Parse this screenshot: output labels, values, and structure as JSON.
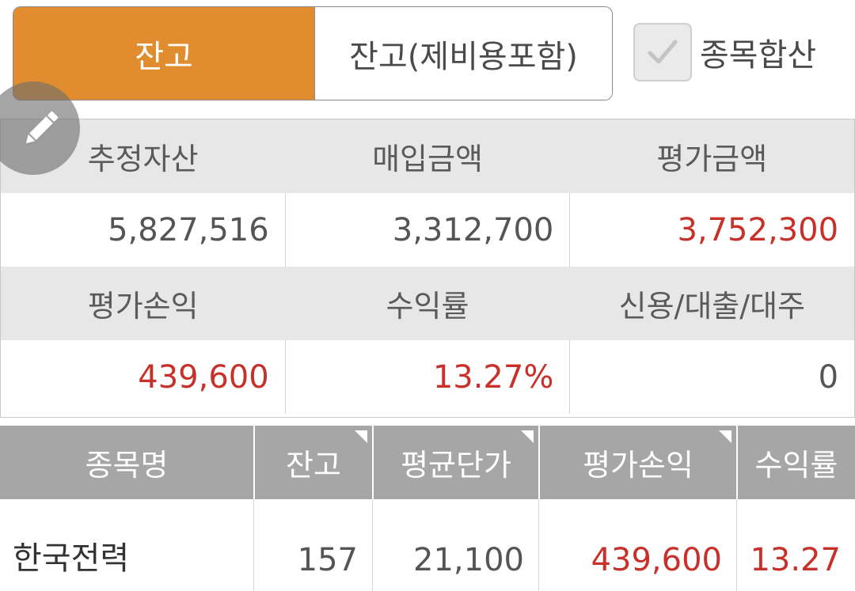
{
  "tabs": {
    "active": "잔고",
    "inactive": "잔고(제비용포함)"
  },
  "aggregate": {
    "label": "종목합산",
    "checked": true
  },
  "summary": {
    "row1_headers": [
      "추정자산",
      "매입금액",
      "평가금액"
    ],
    "row1_values": [
      "5,827,516",
      "3,312,700",
      "3,752,300"
    ],
    "row2_headers": [
      "평가손익",
      "수익률",
      "신용/대출/대주"
    ],
    "row2_values": [
      "439,600",
      "13.27%",
      "0"
    ]
  },
  "holdings": {
    "columns": [
      "종목명",
      "잔고",
      "평균단가",
      "평가손익",
      "수익률"
    ],
    "rows": [
      {
        "name": "한국전력",
        "qty": "157",
        "avg_price": "21,100",
        "pnl": "439,600",
        "rate": "13.27"
      }
    ]
  },
  "colors": {
    "accent": "#e18c2f",
    "positive": "#c8302a"
  },
  "icons": {
    "edit": "pencil-icon",
    "check": "checkmark-icon"
  }
}
